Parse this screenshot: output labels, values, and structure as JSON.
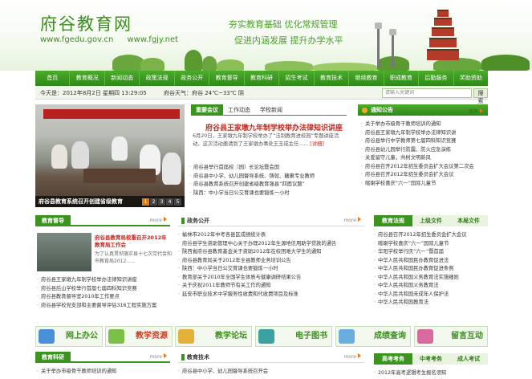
{
  "header": {
    "site_title": "府谷教育网",
    "url1": "www.fgedu.gov.cn",
    "url2": "www.fgjy.net",
    "slogan1": "夯实教育基础  优化常规管理",
    "slogan2": "促进内涵发展  提升办学水平"
  },
  "nav": [
    "首页",
    "教育概况",
    "新闻动态",
    "政策法规",
    "政务公开",
    "教育督导",
    "教育科研",
    "招生考试",
    "教育技术",
    "继续教育",
    "职成教育",
    "后勤服务",
    "奖助资助"
  ],
  "info": {
    "date": "今天是：2012年8月2日 星期四 13:29:05",
    "weather": "府谷天气：府谷  24℃~33℃ 阴",
    "search_placeholder": "请输入关键词",
    "search_btn": "搜 索"
  },
  "slide": {
    "caption": "府谷县教育系统召开创建省级教育",
    "pages": [
      "1",
      "2",
      "3",
      "4",
      "5"
    ]
  },
  "news_tabs": [
    "重要会议",
    "工作动态",
    "学校新闻"
  ],
  "headline": "府谷县王家墩九年制学校举办法律知识讲座",
  "summary": "6月20日，王家墩九年制学校举办了“法制教育进校园”专题讲座活动，这次活动邀请到了王家墩办事处王玉成主任......",
  "summary_more": "[详细]",
  "news_list": [
    "府谷县举行首届校（园）长论坛暨会国",
    "府谷县中小学、幼儿园督导系统、铸就、糖裹专业教师",
    "府谷县教育系统召开创建省级教育强县“四面议题”",
    "陕西：中小学当日公交育课也要锻炼一小时"
  ],
  "notice": {
    "title": "通知公告",
    "more": "更多",
    "items": [
      "关于举办市级骨干教师培训的通知",
      "府谷县王家墩九年制学校举办法律知识讲",
      "府谷县举行中学教师第七届四科知识竞赛",
      "府谷县幼儿园举行防震、防火应急演练",
      "关爱留守儿童，共树文明新风",
      "府谷县召开2012年招生委员会扩大会议第二次会",
      "府谷县召开2012年招生委员会扩大会议",
      "喀喇学校喜庆“六一”国际儿童节"
    ]
  },
  "duxue": {
    "title": "教育督导",
    "more": "more",
    "thumb_title": "府谷县教育局校重召开2012年教育局工作会",
    "thumb_desc": "为了认真贯彻落实县十七次党代会和市教育局2012......",
    "items": [
      "府谷县王家墩九年制学校举办法律知识讲座",
      "府谷县后山学校举行首届七届四科知识竞赛",
      "府谷县教育督导室2010年工作要点",
      "府谷县学校党支部和主要督导评估316工程实施方案"
    ]
  },
  "zhengwu": {
    "title": "政务公开",
    "more": "more",
    "items": [
      "榆林市2012年中考各县区成绩统计表",
      "府谷县学生资助管理中心关于办理2012年生源地信用助学贷款的通告",
      "陕西省府谷县教育基金关于资助2012年在校困难大学生的通知",
      "府谷县教育局关于2012年全县教师业务培训公告",
      "陕西：中小学当日公交育课也要锻炼一小时",
      "教育部关于2010年全国学生体质与健康调研结果公告",
      "关于庆祝2011年教师节有关工作的通知",
      "延安市职业技术中学服务性收费和代收费项目及标准"
    ]
  },
  "jiaoyufa": {
    "tabs": [
      "教育法规",
      "上级文件",
      "本局文件"
    ],
    "items": [
      "府谷县召开2012年招生委员会扩大会议",
      "喀喇学校喜庆“六一”国际儿童节",
      "华阳学校举行庆“六一”暨首届",
      "中华人民共和国民办教育促进法",
      "中华人民共和国民办教育促进条例",
      "中华人民共和国义务教育法实施细则",
      "中华人民共和国义务教育法",
      "中华人民共和国未成年人保护法",
      "中华人民共和国教育法"
    ]
  },
  "services": [
    "网上办公",
    "教学资源",
    "教学论坛",
    "电子图书",
    "成绩查询",
    "留言互动"
  ],
  "keyan": {
    "title": "教育科研",
    "more": "more",
    "items": [
      "关于举办市级骨干教师培训的通知"
    ]
  },
  "jishu": {
    "title": "教育技术",
    "more": "more",
    "items": [
      "府谷县中小学、幼儿园督导系统召开会"
    ]
  },
  "gaokao": {
    "tabs": [
      "高考考务",
      "中考考务",
      "成人考试"
    ],
    "items": [
      "2012年高考逻辑考生报名须知"
    ]
  }
}
